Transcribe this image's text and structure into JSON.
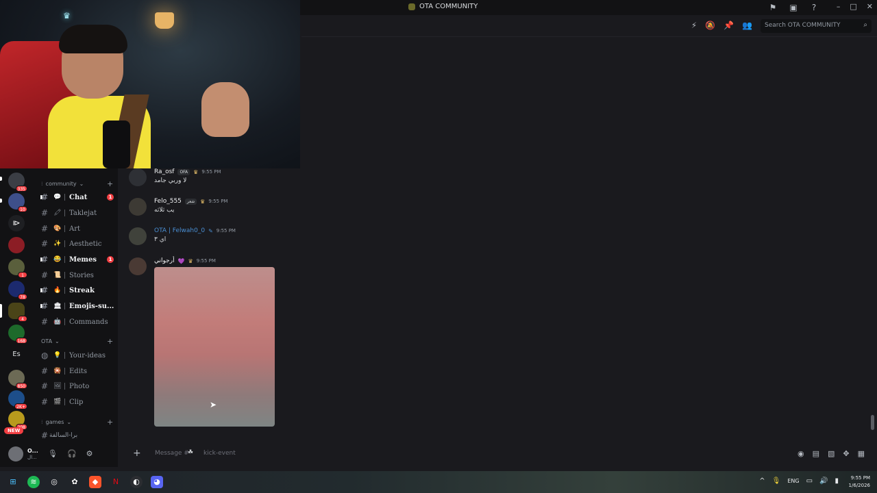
{
  "titlebar": {
    "title": "OTA COMMUNITY"
  },
  "header": {
    "search_placeholder": "Search OTA COMMUNITY"
  },
  "servers": [
    {
      "badge": "335"
    },
    {
      "badge": "10"
    },
    {
      "badge": ""
    },
    {
      "badge": ""
    },
    {
      "badge": "1"
    },
    {
      "badge": "78"
    },
    {
      "badge": "4"
    },
    {
      "badge": "168"
    },
    {
      "label": "Es"
    },
    {
      "badge": "850"
    },
    {
      "badge": "2K+"
    },
    {
      "badge": "208"
    }
  ],
  "new_badge": "NEW",
  "categories": {
    "community": "community",
    "ota": "OTA",
    "games": "games"
  },
  "channels": [
    {
      "name": "Chat",
      "emoji": "💬",
      "unread": true,
      "badge": "1"
    },
    {
      "name": "Taklejat",
      "emoji": "🖍",
      "unread": false,
      "badge": ""
    },
    {
      "name": "Art",
      "emoji": "🎨",
      "unread": false,
      "badge": ""
    },
    {
      "name": "Aesthetic",
      "emoji": "✨",
      "unread": false,
      "badge": ""
    },
    {
      "name": "Memes",
      "emoji": "😂",
      "unread": true,
      "badge": "1"
    },
    {
      "name": "Stories",
      "emoji": "📜",
      "unread": false,
      "badge": ""
    },
    {
      "name": "Streak",
      "emoji": "🔥",
      "unread": true,
      "badge": ""
    },
    {
      "name": "Emojis-su...",
      "emoji": "🏛",
      "unread": true,
      "badge": ""
    },
    {
      "name": "Commands",
      "emoji": "🤖",
      "unread": false,
      "badge": ""
    }
  ],
  "ota_channels": [
    {
      "name": "Your-ideas",
      "emoji": "💡"
    },
    {
      "name": "Edits",
      "emoji": "🎇"
    },
    {
      "name": "Photo",
      "emoji": "🖼"
    },
    {
      "name": "Clip",
      "emoji": "🎬"
    }
  ],
  "games_channel": "برا-السالفة",
  "user": {
    "name": "O...",
    "status": "ال..."
  },
  "messages": [
    {
      "name": "Ra_osf",
      "tag": "OFA",
      "time": "9:55 PM",
      "text": "لا وربي جامد"
    },
    {
      "name": "Felo_555",
      "tag": "شعر",
      "time": "9:55 PM",
      "text": "يب ثلاثه"
    },
    {
      "name": "OTA | Felwah0_0",
      "tag": "",
      "time": "9:55 PM",
      "text": "اي ٣"
    },
    {
      "name": "أرجواني",
      "tag": "💜",
      "time": "9:55 PM",
      "text": ""
    }
  ],
  "composer": {
    "placeholder": "Message #",
    "channel": "kick-event"
  },
  "taskbar": {
    "lang": "ENG",
    "time": "9:55 PM",
    "date": "1/6/2026"
  }
}
